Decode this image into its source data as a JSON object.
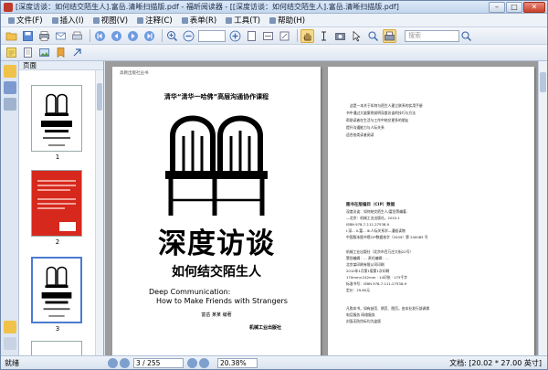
{
  "window": {
    "title": "[深度访谈：如何结交陌生人].富岳.清晰扫描版.pdf - 福昕阅读器 - [[深度访谈：如何结交陌生人].富岳.清晰扫描版.pdf]",
    "minimize": "–",
    "maximize": "□",
    "close": "✕"
  },
  "menu": [
    "文件(F)",
    "插入(I)",
    "视图(V)",
    "注释(C)",
    "表单(R)",
    "工具(T)",
    "帮助(H)"
  ],
  "toolbar": {
    "search_placeholder": "搜索",
    "zoom_value": "",
    "active_tool": "hand-tool"
  },
  "thumbnails": {
    "header": "页面",
    "pages": [
      {
        "num": "1"
      },
      {
        "num": "2"
      },
      {
        "num": "3"
      }
    ]
  },
  "cover": {
    "series": "高教出版社丛书",
    "top_line": "清华“清华一哈佛”高层沟通协作课程",
    "title": "深度访谈",
    "subtitle": "如何结交陌生人",
    "english_1": "Deep Communication:",
    "english_2": "How to Make Friends with Strangers",
    "author": "富岳  某某  编著",
    "publisher": "机械工业出版社"
  },
  "copyright_page": {
    "intro_lines": [
      "这是一本关于如何与陌生人建立联系的实用手册",
      "书中通过大量案例说明深度访谈的技巧与方法",
      "帮助读者在生活与工作中结交更多的朋友",
      "提升沟通能力与人际关系",
      "适合各类读者阅读"
    ],
    "cip_title": "图书在版编目（CIP）数据",
    "cip_lines": [
      "深度访谈：如何结交陌生人/富岳等编著.",
      "—北京：机械工业出版社，2010.1",
      "ISBN 978-7-111-27538-9",
      "Ⅰ.深…  Ⅱ.富…  Ⅲ.人际关系学—通俗读物",
      "中国版本图书馆CIP数据核字（2009）第 240085 号"
    ],
    "pub_lines": [
      "机械工业出版社（北京市百万庄大街22号）",
      "策划编辑：…  责任编辑：…",
      "北京某印刷有限公司印刷",
      "2010年1月第1版第1次印刷",
      "170mm×242mm · 14印张 · 175千字",
      "标准书号：ISBN 978-7-111-27538-9",
      "定价：29.80元"
    ],
    "footer_lines": [
      "凡购本书，如有缺页、倒页、脱页，由本社发行部调换",
      "电话服务  网络服务",
      "封面无防伪标均为盗版"
    ]
  },
  "statusbar": {
    "left": "就绪",
    "page": "3 / 255",
    "zoom": "20.38%",
    "size": "文档: [20.02 * 27.00 英寸]"
  },
  "colors": {
    "cover2_red": "#d6281c",
    "accent": "#4b7bd1"
  }
}
